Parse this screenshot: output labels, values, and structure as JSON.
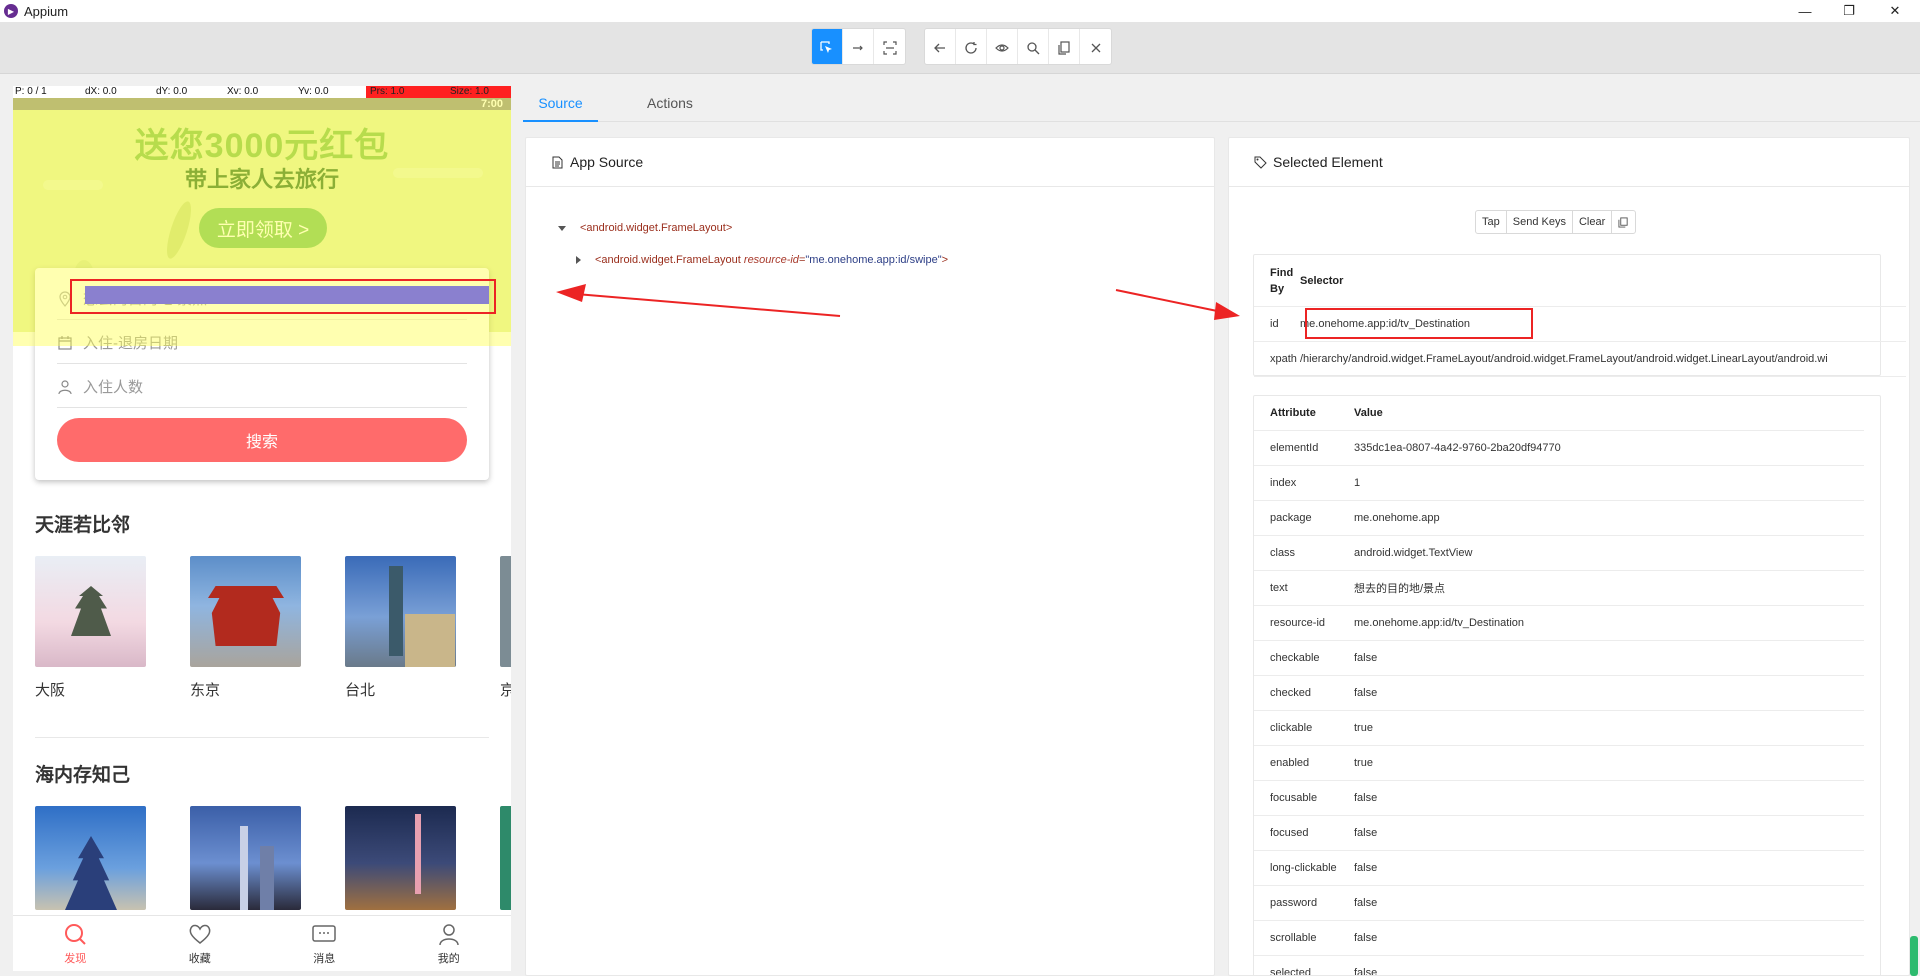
{
  "window": {
    "title": "Appium"
  },
  "toolbar": {
    "buttons": [
      "select-elements",
      "swipe",
      "tap-coordinates",
      "back",
      "refresh",
      "toggle-attributes",
      "search",
      "copy-xml",
      "quit-session"
    ]
  },
  "phone": {
    "pointer": {
      "p": "P: 0 / 1",
      "dx": "dX: 0.0",
      "dy": "dY: 0.0",
      "xv": "Xv: 0.0",
      "yv": "Yv: 0.0",
      "prs": "Prs: 1.0",
      "size": "Size: 1.0"
    },
    "status_time": "7:00",
    "banner": {
      "line1": "送您3000元红包",
      "line2": "带上家人去旅行",
      "button": "立即领取 >"
    },
    "search": {
      "destination": "想去的目的地/景点",
      "dates": "入住-退房日期",
      "guests": "入住人数",
      "button": "搜索"
    },
    "section1": {
      "title": "天涯若比邻",
      "cities": [
        "大阪",
        "东京",
        "台北",
        "京"
      ]
    },
    "section2": {
      "title": "海内存知己"
    },
    "tabs": [
      "发现",
      "收藏",
      "消息",
      "我的"
    ]
  },
  "main_tabs": [
    "Source",
    "Actions"
  ],
  "source_panel": {
    "title": "App Source",
    "tree": {
      "root": "<android.widget.FrameLayout>",
      "child_tag": "<android.widget.FrameLayout ",
      "child_attr": "resource-id",
      "child_eq": "=",
      "child_val": "\"me.onehome.app:id/swipe\"",
      "child_end": ">"
    }
  },
  "selected_panel": {
    "title": "Selected Element",
    "actions": [
      "Tap",
      "Send Keys",
      "Clear"
    ],
    "selector_table": {
      "headers": [
        "Find By",
        "Selector"
      ],
      "rows": [
        {
          "by": "id",
          "selector": "me.onehome.app:id/tv_Destination"
        },
        {
          "by": "xpath",
          "selector": "/hierarchy/android.widget.FrameLayout/android.widget.FrameLayout/android.widget.LinearLayout/android.wi"
        }
      ]
    },
    "attribute_table": {
      "headers": [
        "Attribute",
        "Value"
      ],
      "rows": [
        {
          "attr": "elementId",
          "value": "335dc1ea-0807-4a42-9760-2ba20df94770"
        },
        {
          "attr": "index",
          "value": "1"
        },
        {
          "attr": "package",
          "value": "me.onehome.app"
        },
        {
          "attr": "class",
          "value": "android.widget.TextView"
        },
        {
          "attr": "text",
          "value": "想去的目的地/景点"
        },
        {
          "attr": "resource-id",
          "value": "me.onehome.app:id/tv_Destination"
        },
        {
          "attr": "checkable",
          "value": "false"
        },
        {
          "attr": "checked",
          "value": "false"
        },
        {
          "attr": "clickable",
          "value": "true"
        },
        {
          "attr": "enabled",
          "value": "true"
        },
        {
          "attr": "focusable",
          "value": "false"
        },
        {
          "attr": "focused",
          "value": "false"
        },
        {
          "attr": "long-clickable",
          "value": "false"
        },
        {
          "attr": "password",
          "value": "false"
        },
        {
          "attr": "scrollable",
          "value": "false"
        },
        {
          "attr": "selected",
          "value": "false"
        }
      ]
    }
  },
  "colors": {
    "accent": "#1890ff",
    "highlight_box": "#ec2424",
    "search_button": "#ff6b6b",
    "active_tab": "#ff5a5a"
  }
}
